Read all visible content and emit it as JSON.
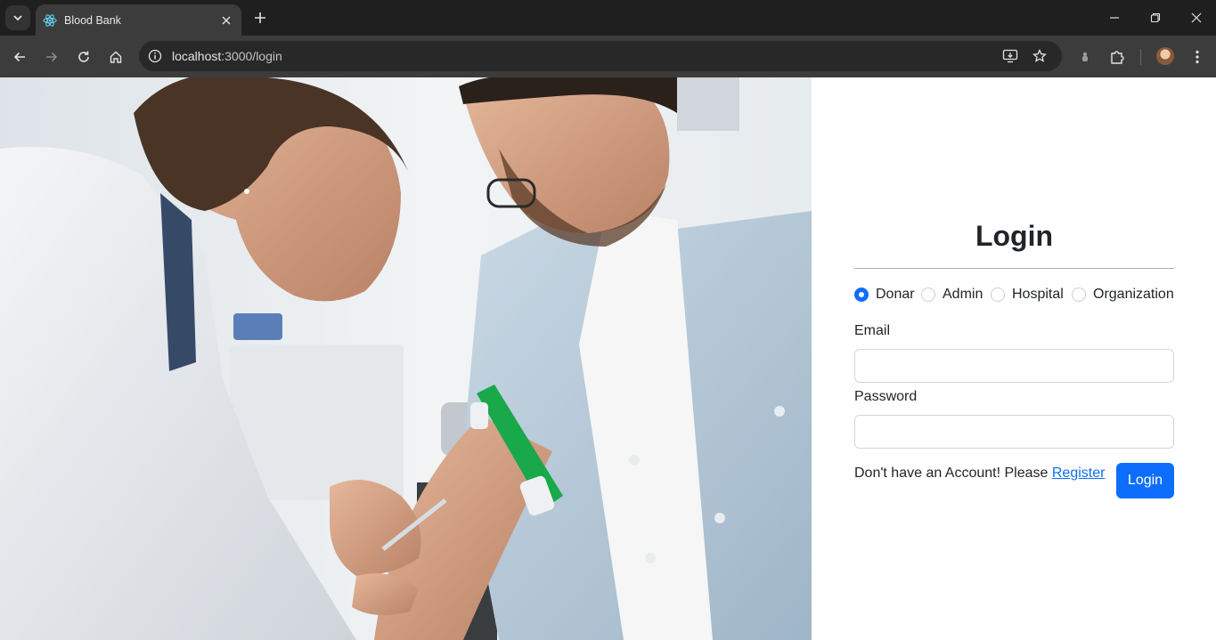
{
  "browser": {
    "tab_title": "Blood Bank",
    "url_host": "localhost",
    "url_path": ":3000/login"
  },
  "hero_image": {
    "icon": "blood-draw-photo"
  },
  "login": {
    "title": "Login",
    "roles": [
      {
        "label": "Donar",
        "checked": true
      },
      {
        "label": "Admin",
        "checked": false
      },
      {
        "label": "Hospital",
        "checked": false
      },
      {
        "label": "Organization",
        "checked": false
      }
    ],
    "email_label": "Email",
    "email_value": "",
    "password_label": "Password",
    "password_value": "",
    "register_prompt": "Don't have an Account! Please ",
    "register_link": "Register",
    "submit_label": "Login"
  },
  "colors": {
    "primary": "#0d6efd",
    "text": "#212529",
    "chrome_dark": "#1f1f1f",
    "chrome_toolbar": "#3c3c3c"
  }
}
